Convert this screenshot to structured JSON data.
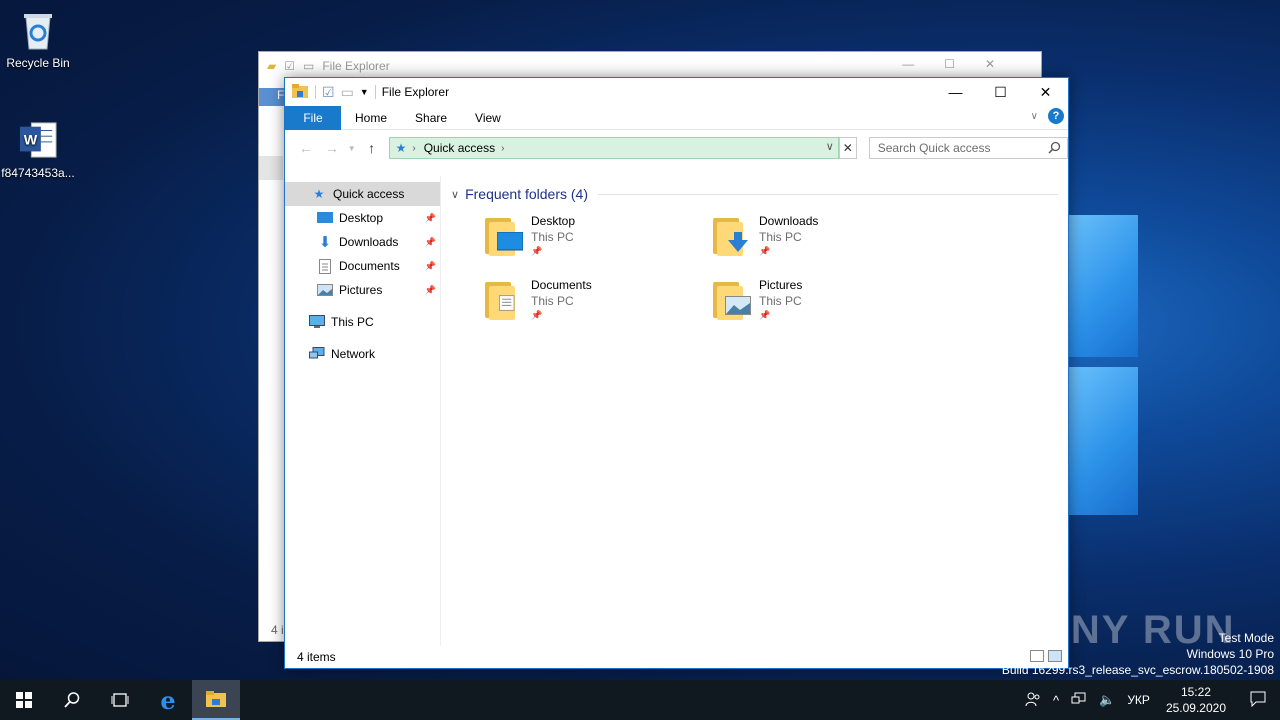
{
  "desktop": {
    "icons": [
      {
        "label": "Recycle Bin",
        "icon": "recycle-bin-icon"
      },
      {
        "label": "f84743453a...",
        "icon": "word-document-icon"
      }
    ]
  },
  "back_window": {
    "title": "File Explorer",
    "status_fragment": "4 i",
    "file_tab_fragment": "F"
  },
  "window": {
    "title": "File Explorer",
    "controls": {
      "minimize": "—",
      "maximize": "☐",
      "close": "✕"
    },
    "ribbon": {
      "tabs": [
        "File",
        "Home",
        "Share",
        "View"
      ],
      "help": "?"
    },
    "address": {
      "location": "Quick access",
      "search_placeholder": "Search Quick access"
    },
    "nav": {
      "items": [
        {
          "label": "Quick access",
          "icon": "star-icon",
          "pinned": false,
          "selected": true
        },
        {
          "label": "Desktop",
          "icon": "desktop-icon",
          "pinned": true
        },
        {
          "label": "Downloads",
          "icon": "download-arrow-icon",
          "pinned": true
        },
        {
          "label": "Documents",
          "icon": "document-icon",
          "pinned": true
        },
        {
          "label": "Pictures",
          "icon": "pictures-icon",
          "pinned": true
        },
        {
          "label": "This PC",
          "icon": "computer-icon",
          "pinned": false
        },
        {
          "label": "Network",
          "icon": "network-icon",
          "pinned": false
        }
      ]
    },
    "group": {
      "title": "Frequent folders (4)"
    },
    "folders": [
      {
        "name": "Desktop",
        "location": "This PC"
      },
      {
        "name": "Downloads",
        "location": "This PC"
      },
      {
        "name": "Documents",
        "location": "This PC"
      },
      {
        "name": "Pictures",
        "location": "This PC"
      }
    ],
    "status": "4 items"
  },
  "watermark": {
    "line1": "Test Mode",
    "line2": "Windows 10 Pro",
    "line3": "Build 16299.rs3_release_svc_escrow.180502-1908",
    "brand": "ANY RUN"
  },
  "taskbar": {
    "language": "УКР",
    "time": "15:22",
    "date": "25.09.2020"
  },
  "colors": {
    "accent": "#1979ca",
    "address_bg": "#d9f1e0",
    "group_title": "#1e3287"
  }
}
